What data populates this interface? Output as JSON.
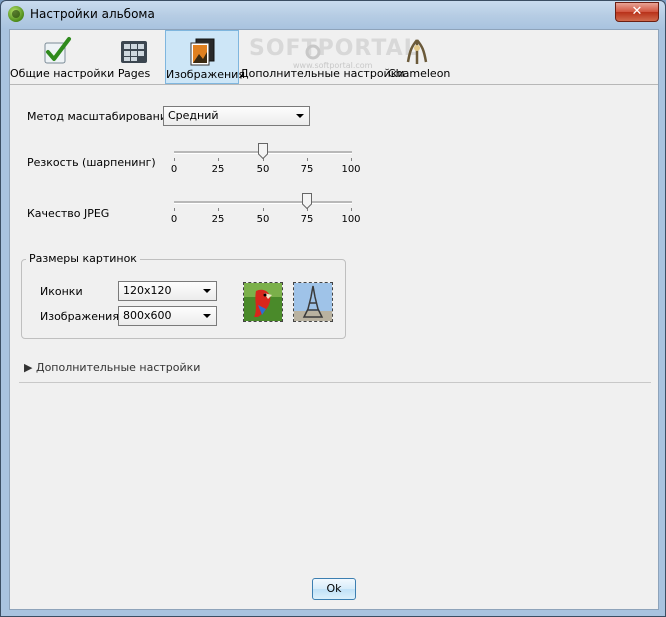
{
  "window": {
    "title": "Настройки альбома",
    "close_glyph": "✕"
  },
  "watermark": {
    "text": "SOFTPORTAL",
    "sub": "www.softportal.com",
    "mark": "TM"
  },
  "toolbar": {
    "items": [
      {
        "label": "Общие настройки",
        "icon": "checkmark-icon"
      },
      {
        "label": "Pages",
        "icon": "pages-grid-icon"
      },
      {
        "label": "Изображения",
        "icon": "images-icon"
      },
      {
        "label": "Дополнительные настройки",
        "icon": "settings-icon"
      },
      {
        "label": "Chameleon",
        "icon": "chameleon-icon"
      }
    ]
  },
  "scaling": {
    "label": "Метод масштабирования",
    "value": "Средний"
  },
  "sharpening": {
    "label": "Резкость (шарпенинг)",
    "value": 50,
    "ticks": [
      "0",
      "25",
      "50",
      "75",
      "100"
    ]
  },
  "jpeg_quality": {
    "label": "Качество JPEG",
    "value": 75,
    "ticks": [
      "0",
      "25",
      "50",
      "75",
      "100"
    ]
  },
  "image_sizes": {
    "title": "Размеры картинок",
    "icons": {
      "label": "Иконки",
      "value": "120x120"
    },
    "images": {
      "label": "Изображения",
      "value": "800x600"
    }
  },
  "advanced": {
    "label": "Дополнительные настройки",
    "glyph": "▶"
  },
  "ok_label": "Ok"
}
